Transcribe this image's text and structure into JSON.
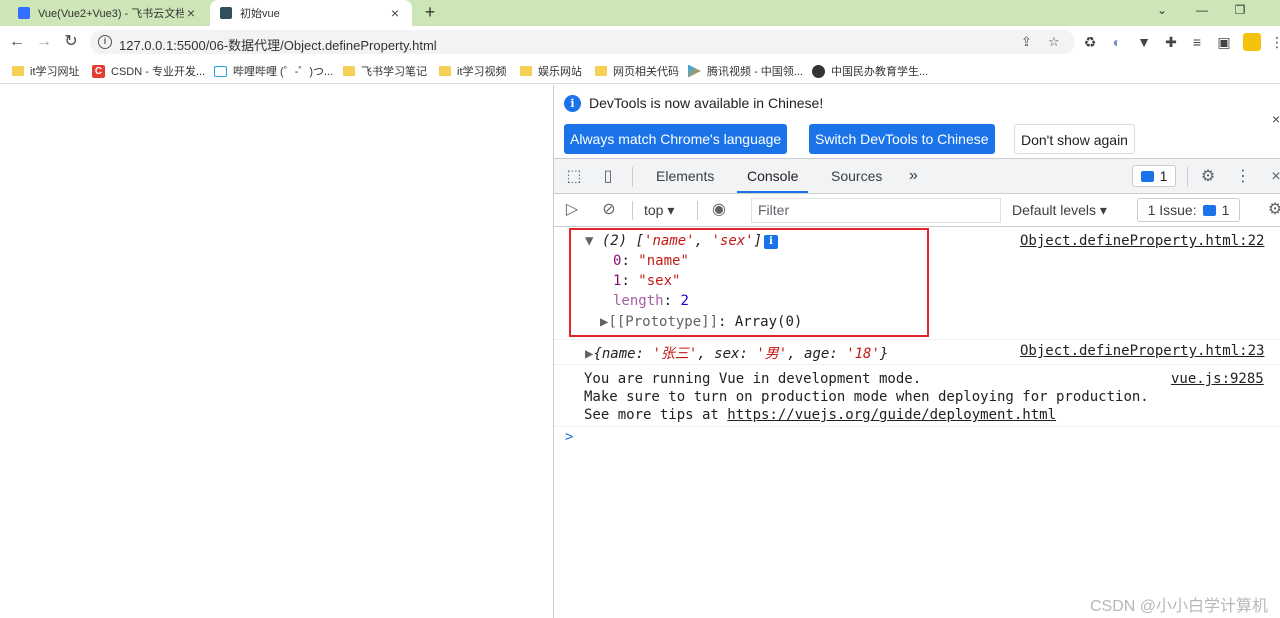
{
  "browser": {
    "tabs": [
      {
        "title": "Vue(Vue2+Vue3) - 飞书云文档",
        "active": false
      },
      {
        "title": "初始vue",
        "active": true
      }
    ],
    "new_tab": "+",
    "url": "127.0.0.1:5500/06-数据代理/Object.defineProperty.html",
    "bookmarks": [
      "it学习网址",
      "CSDN - 专业开发...",
      "哔哩哔哩 (゜-゜)つ...",
      "飞书学习笔记",
      "it学习视频",
      "娱乐网站",
      "网页相关代码",
      "腾讯视频 - 中国领...",
      "中国民办教育学生..."
    ]
  },
  "devtools": {
    "infobar": {
      "message": "DevTools is now available in Chinese!",
      "btn_match": "Always match Chrome's language",
      "btn_switch": "Switch DevTools to Chinese",
      "btn_dismiss": "Don't show again"
    },
    "tabs": {
      "elements": "Elements",
      "console": "Console",
      "sources": "Sources",
      "more": "»"
    },
    "message_count": "1",
    "filterbar": {
      "context": "top",
      "filter_placeholder": "Filter",
      "levels": "Default levels",
      "issues_label": "1 Issue:",
      "issues_count": "1"
    },
    "console": {
      "array": {
        "header_prefix": "(2) [",
        "items": [
          "'name'",
          "'sex'"
        ],
        "header_suffix": "]",
        "entries": [
          {
            "key": "0",
            "value": "\"name\""
          },
          {
            "key": "1",
            "value": "\"sex\""
          }
        ],
        "length_key": "length",
        "length_value": "2",
        "prototype_key": "[[Prototype]]",
        "prototype_value": "Array(0)",
        "source": "Object.defineProperty.html:22"
      },
      "object": {
        "k1": "name",
        "v1": "'张三'",
        "k2": "sex",
        "v2": "'男'",
        "k3": "age",
        "v3": "'18'",
        "source": "Object.defineProperty.html:23"
      },
      "vue_message": {
        "line1": "You are running Vue in development mode.",
        "line2": "Make sure to turn on production mode when deploying for production.",
        "line3_prefix": "See more tips at ",
        "line3_link": "https://vuejs.org/guide/deployment.html",
        "source": "vue.js:9285"
      },
      "prompt": ">"
    }
  },
  "watermark": "CSDN @小小白学计算机",
  "colors": {
    "tabstrip": "#cce6b8",
    "accent": "#1a73e8",
    "highlight_box": "#e4262c"
  }
}
